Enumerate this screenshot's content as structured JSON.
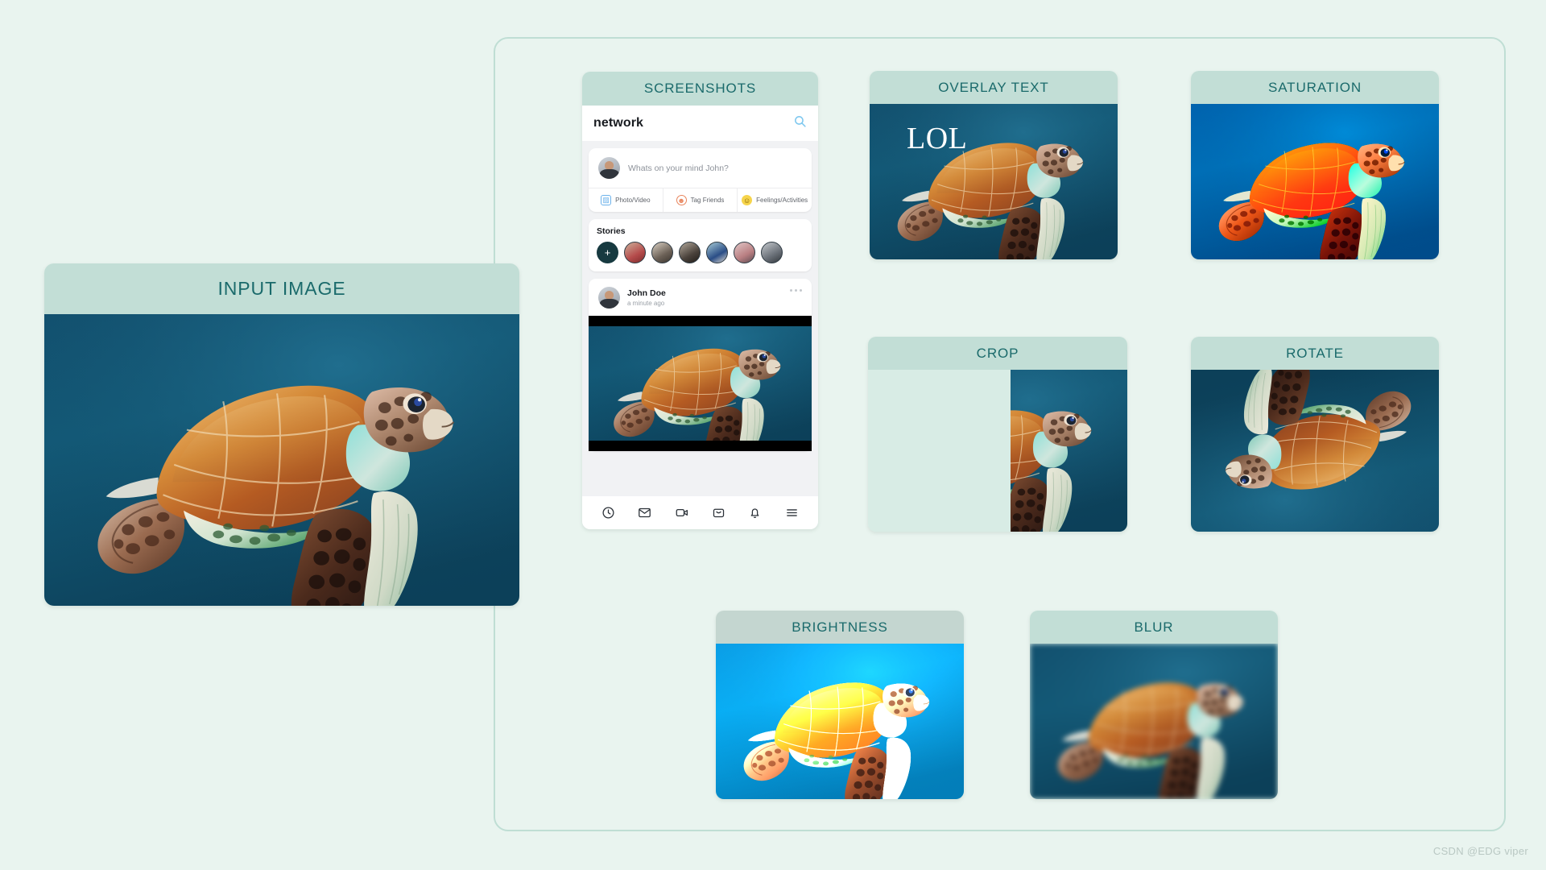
{
  "page": {
    "background_color": "#e9f4ef",
    "header_color": "#c2ded6",
    "header_text_color": "#1a6a6b",
    "watermark": "CSDN @EDG viper"
  },
  "cards": {
    "input": {
      "title": "INPUT IMAGE"
    },
    "screenshots": {
      "title": "SCREENSHOTS"
    },
    "overlay": {
      "title": "OVERLAY TEXT",
      "overlay_text": "LOL"
    },
    "saturation": {
      "title": "SATURATION"
    },
    "crop": {
      "title": "CROP"
    },
    "rotate": {
      "title": "ROTATE"
    },
    "brightness": {
      "title": "BRIGHTNESS"
    },
    "blur": {
      "title": "BLUR"
    }
  },
  "phone": {
    "search": {
      "query": "network",
      "icon": "search-icon"
    },
    "compose": {
      "placeholder": "Whats on your mind John?"
    },
    "actions": [
      {
        "label": "Photo/Video",
        "icon": "photo-icon"
      },
      {
        "label": "Tag Friends",
        "icon": "tag-friends-icon"
      },
      {
        "label": "Feelings/Activities",
        "icon": "emoji-icon"
      }
    ],
    "stories": {
      "title": "Stories",
      "add_label": "+",
      "items": [
        "story-1",
        "story-2",
        "story-3",
        "story-4",
        "story-5",
        "story-6"
      ]
    },
    "post": {
      "author": "John Doe",
      "time": "a minute ago",
      "menu": "more-options"
    },
    "nav": [
      {
        "name": "clock-icon"
      },
      {
        "name": "mail-icon"
      },
      {
        "name": "video-icon"
      },
      {
        "name": "bag-icon"
      },
      {
        "name": "bell-icon"
      },
      {
        "name": "menu-icon"
      }
    ]
  },
  "colors": {
    "water_deep": "#0f4c6b",
    "water_mid": "#17647f",
    "shell_orange": "#c2641f",
    "shell_light": "#e5a052",
    "flipper_cream": "#e8e4d2",
    "saturation_blue": "#0a7ae8",
    "brightness_cyan": "#2df0f5"
  }
}
